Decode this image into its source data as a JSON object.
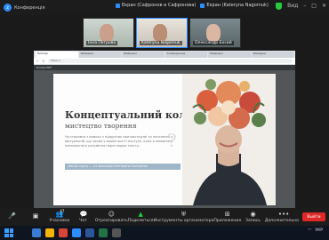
{
  "zoom": {
    "title": "Конференція",
    "share_banner": [
      {
        "label": "Екран (Сафронов и Сафронова)"
      },
      {
        "label": "Екран (Kateryna Nagornuk)"
      }
    ],
    "view_label": "Вид"
  },
  "participants": [
    {
      "name": "Інна Петрова"
    },
    {
      "name": "Kateryna Nagornuk"
    },
    {
      "name": "Олександр Босий"
    }
  ],
  "browser": {
    "tabs": [
      "Вебінар",
      "Wallpaper",
      "Wallpaper",
      "Конференція",
      "Wallpaper",
      "Wallpaper"
    ],
    "address": "https://...",
    "viewer_title": "Колаж PDF"
  },
  "slide": {
    "title": "Концептуальний колаж",
    "subtitle": "мистецтво творення",
    "body": "Чи стикався з кимось з підручних при мистецтві та натхненні у віртуальній, що часом у вашім житті поступу, коли в немовлені незалежного розуміння переглядом тексту.",
    "qmark": "?",
    "bar_text": "лекція курсу — от викладач Катерина Нагорнюк"
  },
  "toolbar": {
    "items": [
      {
        "label": "",
        "icon": "mic-icon"
      },
      {
        "label": "",
        "icon": "video-icon"
      },
      {
        "label": "Учасники",
        "icon": "participants-icon",
        "badge": "47"
      },
      {
        "label": "Чат",
        "icon": "chat-icon"
      },
      {
        "label": "Отреагировать",
        "icon": "react-icon"
      },
      {
        "label": "Поделиться",
        "icon": "share-icon"
      },
      {
        "label": "Инструменты организатора",
        "icon": "host-tools-icon"
      },
      {
        "label": "Приложения",
        "icon": "apps-icon"
      },
      {
        "label": "Запись",
        "icon": "record-icon"
      },
      {
        "label": "Дополнительно",
        "icon": "more-icon"
      }
    ],
    "end": "Выйти"
  },
  "taskbar": {
    "tray_lang": "УКР",
    "time": ""
  },
  "colors": {
    "accent": "#2d8cff",
    "end_red": "#e02828"
  }
}
